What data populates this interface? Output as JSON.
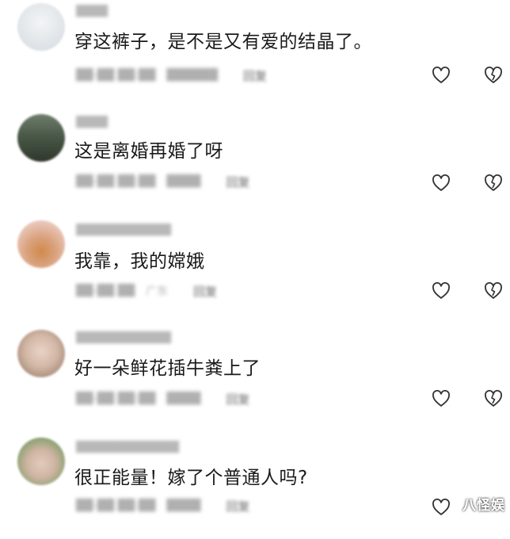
{
  "comments": [
    {
      "username": "████",
      "text": "穿这裤子，是不是又有爱的结晶了。",
      "time": "██-██ ██:██",
      "location": "██████",
      "reply_label": "回复",
      "avatar_colors": [
        "#eef1f3",
        "#d9dee3"
      ]
    },
    {
      "username": "████",
      "text": "这是离婚再婚了呀",
      "time": "██-██ ██:██",
      "location": "████",
      "reply_label": "回复",
      "avatar_colors": [
        "#3e4a3c",
        "#8a9a8a"
      ]
    },
    {
      "username": "████████████",
      "text": "我靠，我的嫦娥",
      "time": "██-██ ██",
      "location": "广东",
      "reply_label": "回复",
      "avatar_colors": [
        "#e0b6a4",
        "#c98a5a"
      ]
    },
    {
      "username": "████████████",
      "text": "好一朵鲜花插牛粪上了",
      "time": "██-██ ██:██",
      "location": "████",
      "reply_label": "回复",
      "avatar_colors": [
        "#e8d6cc",
        "#b79a88"
      ]
    },
    {
      "username": "█████████████",
      "text": "很正能量！嫁了个普通人吗?",
      "time": "██-██ ██:██",
      "location": "████",
      "reply_label": "回复",
      "avatar_colors": [
        "#8fa878",
        "#d9c2b0"
      ]
    }
  ],
  "watermark": "八怪娱",
  "icons": {
    "like": "heart-outline-icon",
    "dislike": "broken-heart-icon"
  },
  "colors": {
    "comment_text": "#1a1a1a",
    "meta_text": "#b0b0b0",
    "icon_stroke": "#333333"
  }
}
